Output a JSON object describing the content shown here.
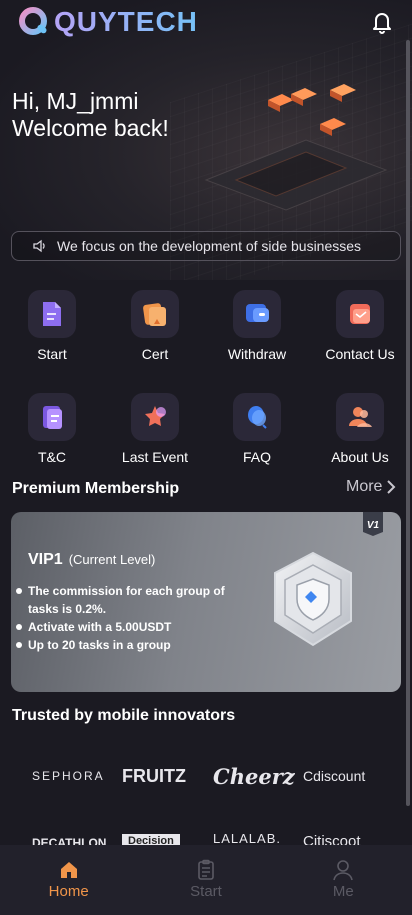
{
  "header": {
    "logo_text": "QUYTECH"
  },
  "greeting": {
    "line1": "Hi, MJ_jmmi",
    "line2": "Welcome back!"
  },
  "notice": {
    "text": "We focus on the development of side businesses"
  },
  "menu": [
    {
      "label": "Start",
      "icon": "document-icon"
    },
    {
      "label": "Cert",
      "icon": "certificate-icon"
    },
    {
      "label": "Withdraw",
      "icon": "wallet-icon"
    },
    {
      "label": "Contact Us",
      "icon": "envelope-icon"
    },
    {
      "label": "T&C",
      "icon": "terms-icon"
    },
    {
      "label": "Last Event",
      "icon": "star-icon"
    },
    {
      "label": "FAQ",
      "icon": "question-icon"
    },
    {
      "label": "About Us",
      "icon": "people-icon"
    }
  ],
  "membership": {
    "title": "Premium Membership",
    "more": "More",
    "badge": "V1",
    "level": "VIP1",
    "current": "(Current Level)",
    "benefits": [
      "The commission for each group of tasks is 0.2%.",
      "Activate with a 5.00USDT",
      "Up to 20 tasks in a group"
    ]
  },
  "trusted": {
    "title": "Trusted by mobile innovators",
    "brands_row1": [
      "SEPHORA",
      "FRUITZ",
      "Cheerz",
      "Cdiscount"
    ],
    "brands_row2": [
      "DECATHLON",
      "Decision",
      "LALALAB.",
      "Citiscoot"
    ]
  },
  "tabs": [
    {
      "label": "Home",
      "icon": "home-icon",
      "active": true
    },
    {
      "label": "Start",
      "icon": "clipboard-icon",
      "active": false
    },
    {
      "label": "Me",
      "icon": "user-icon",
      "active": false
    }
  ],
  "colors": {
    "accent": "#f0954a",
    "background": "#1b1a22",
    "logo": "#8db9f7"
  }
}
